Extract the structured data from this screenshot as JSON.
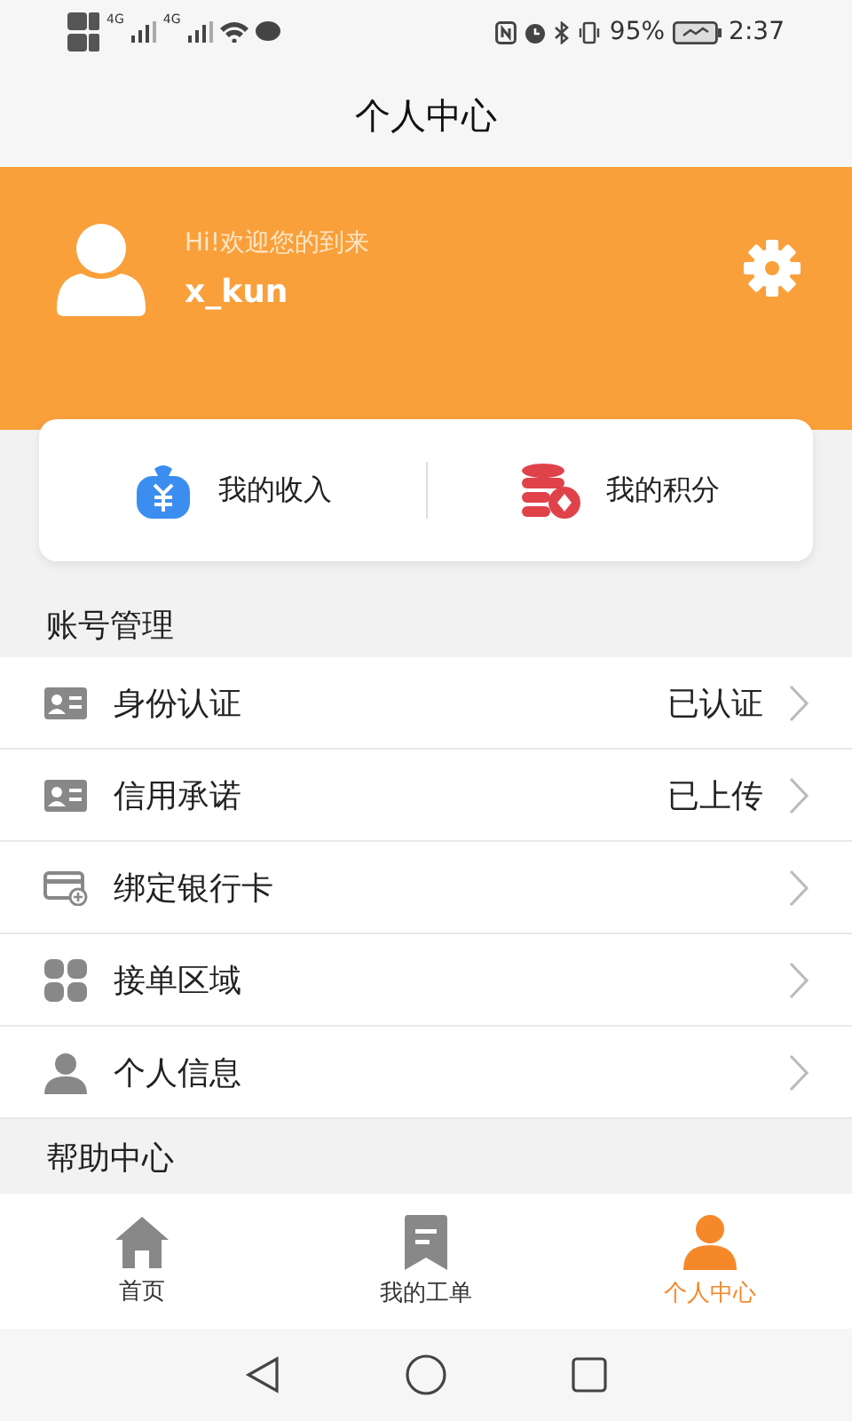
{
  "status_bar": {
    "network": [
      "4G",
      "4G"
    ],
    "battery": "95%",
    "time": "2:37"
  },
  "title": "个人中心",
  "profile": {
    "greeting": "Hi!欢迎您的到来",
    "username": "x_kun"
  },
  "shortcuts": [
    {
      "label": "我的收入",
      "kind": "income"
    },
    {
      "label": "我的积分",
      "kind": "points"
    }
  ],
  "sections": [
    {
      "title": "账号管理",
      "items": [
        {
          "label": "身份认证",
          "status": "已认证",
          "kind": "id-card"
        },
        {
          "label": "信用承诺",
          "status": "已上传",
          "kind": "id-card"
        },
        {
          "label": "绑定银行卡",
          "kind": "bank-card"
        },
        {
          "label": "接单区域",
          "kind": "grid"
        },
        {
          "label": "个人信息",
          "kind": "person"
        }
      ]
    },
    {
      "title": "帮助中心"
    }
  ],
  "tabs": [
    {
      "label": "首页",
      "kind": "home",
      "selected": false
    },
    {
      "label": "我的工单",
      "kind": "order",
      "selected": false
    },
    {
      "label": "个人中心",
      "kind": "person",
      "selected": true
    }
  ]
}
